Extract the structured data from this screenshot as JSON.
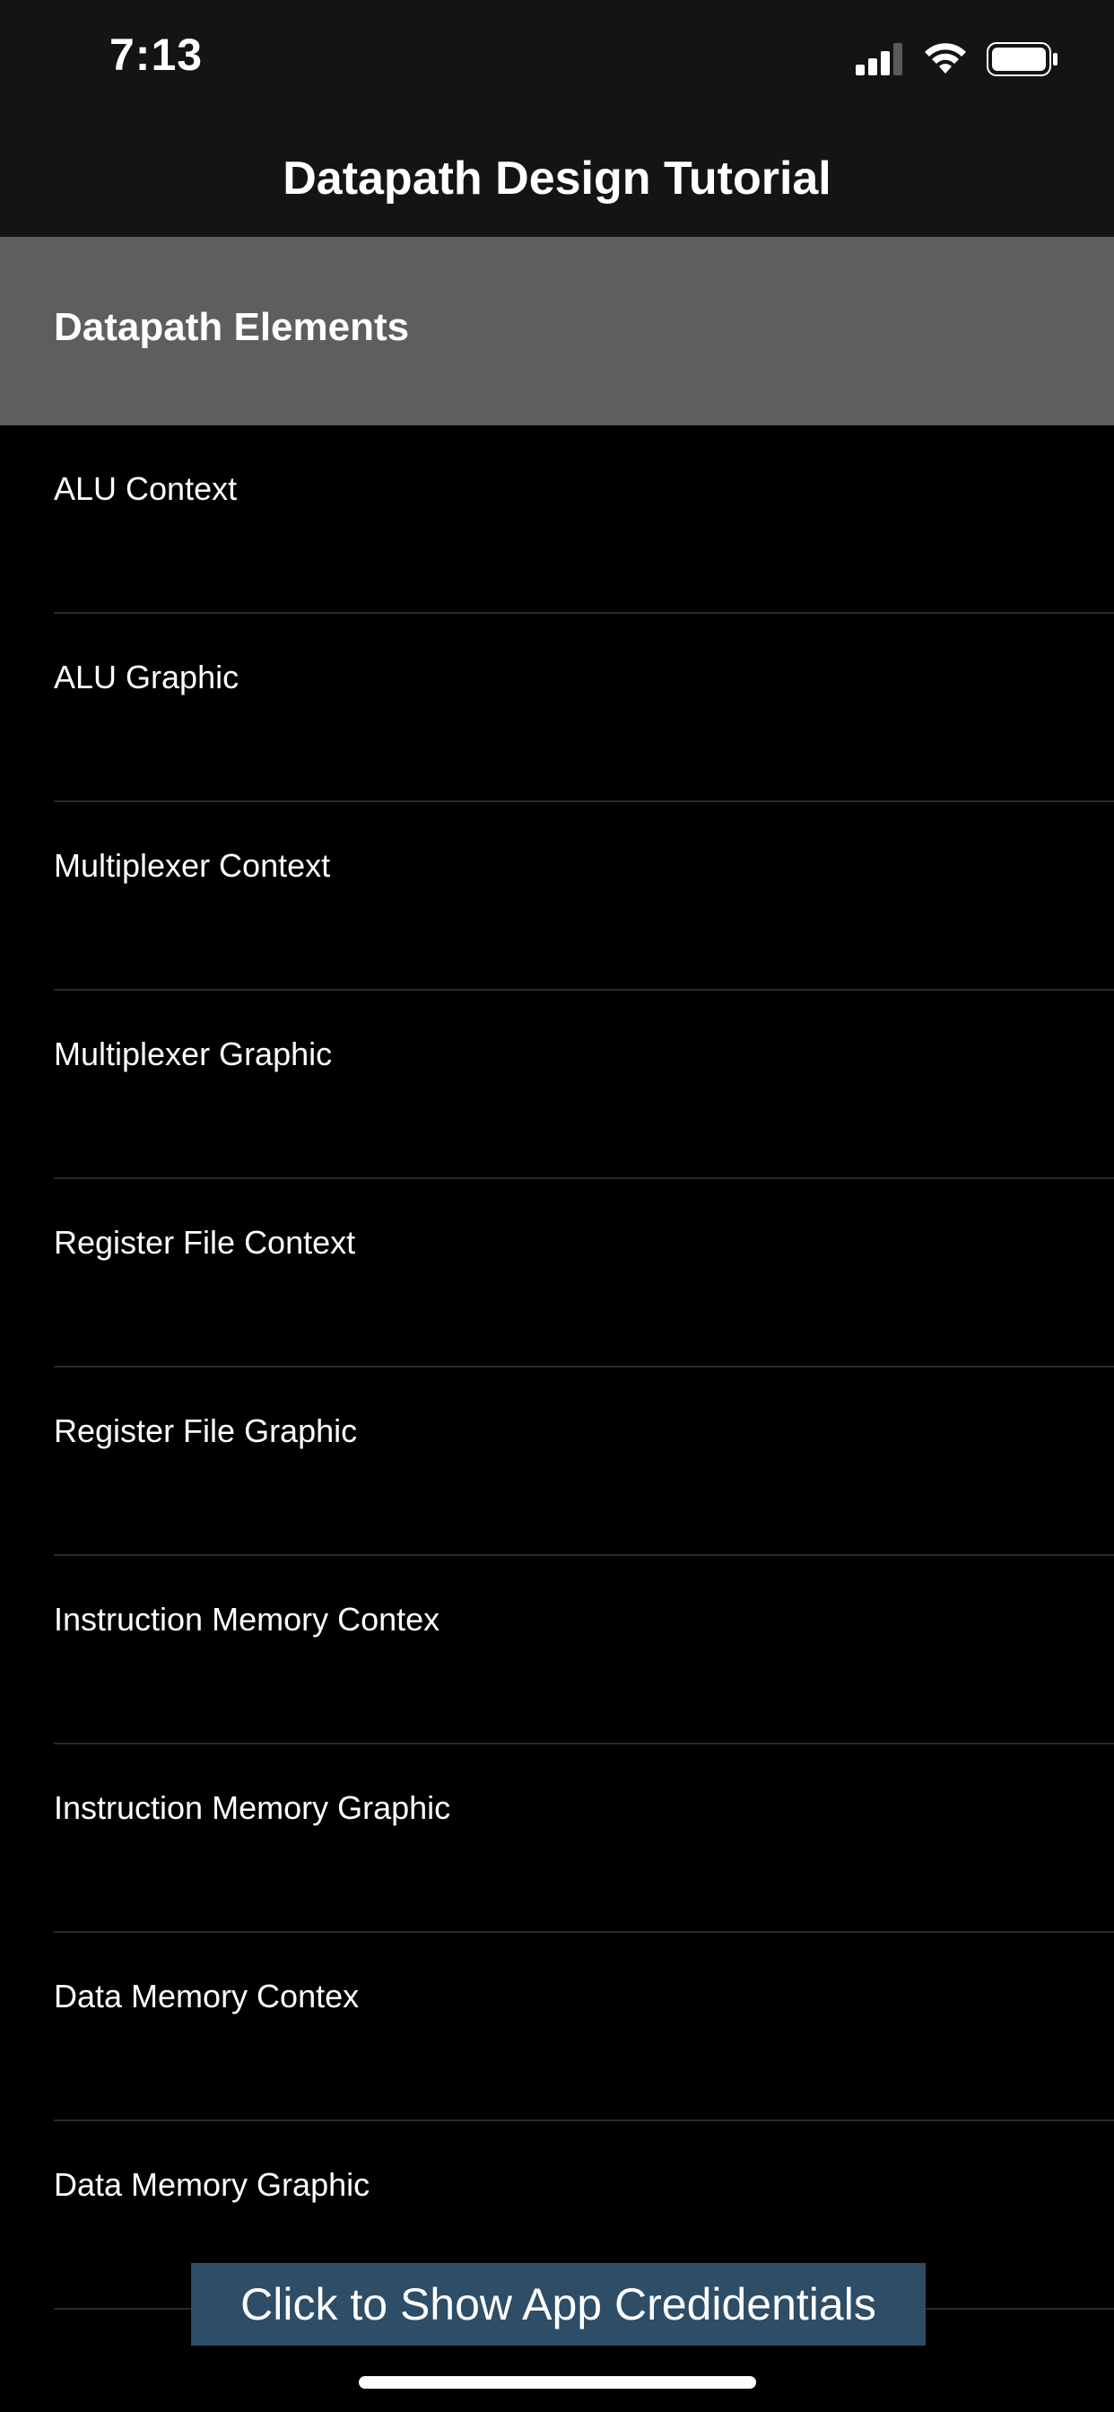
{
  "status_bar": {
    "time": "7:13",
    "icons": [
      "cellular-signal-icon",
      "wifi-icon",
      "battery-icon"
    ]
  },
  "nav": {
    "title": "Datapath Design Tutorial"
  },
  "section": {
    "title": "Datapath Elements"
  },
  "list": {
    "items": [
      {
        "label": "ALU Context"
      },
      {
        "label": "ALU Graphic"
      },
      {
        "label": "Multiplexer Context"
      },
      {
        "label": "Multiplexer Graphic"
      },
      {
        "label": "Register File Context"
      },
      {
        "label": "Register File Graphic"
      },
      {
        "label": "Instruction Memory Contex"
      },
      {
        "label": "Instruction Memory Graphic"
      },
      {
        "label": "Data Memory Contex"
      },
      {
        "label": "Data Memory Graphic"
      }
    ]
  },
  "credentials_button": {
    "label": "Click to Show App Credidentials"
  },
  "colors": {
    "background": "#000000",
    "bar_background": "#141414",
    "section_background": "#5e5e5e",
    "button_background": "#2e4d66",
    "divider": "#2a2a2a",
    "text": "#ffffff"
  }
}
